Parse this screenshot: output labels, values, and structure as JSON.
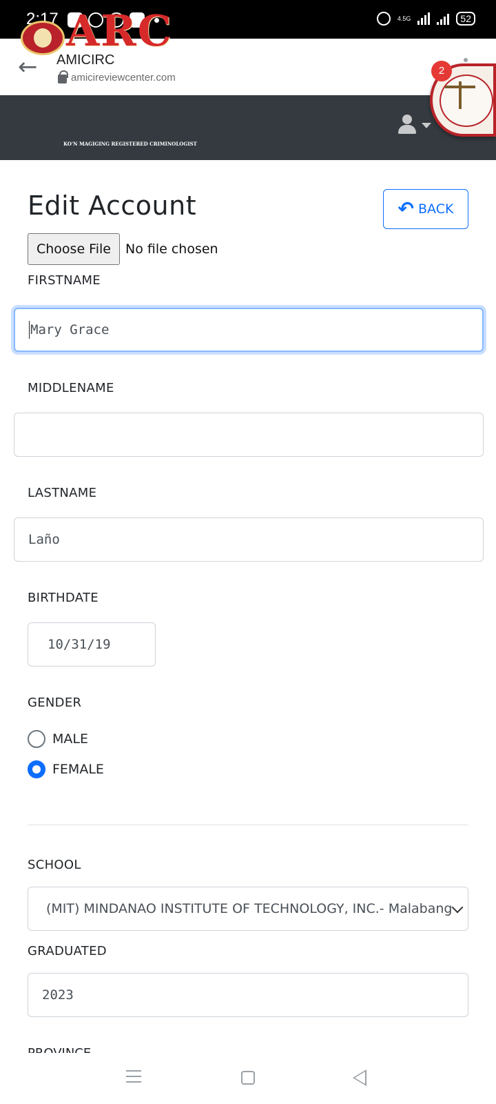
{
  "status_bar": {
    "time": "2:17",
    "network": "4.5G",
    "battery": "52"
  },
  "browser": {
    "page_name": "AMICIRC",
    "url": "amicireviewcenter.com"
  },
  "brand": {
    "logo_text": "ARC",
    "tagline": "KO'N MAGIGING REGISTERED CRIMINOLOGIST",
    "accent": "#d62a2a"
  },
  "chat_head": {
    "badge_count": "2"
  },
  "form": {
    "title": "Edit Account",
    "back_label": "BACK",
    "file": {
      "button_label": "Choose File",
      "status": "No file chosen"
    },
    "firstname": {
      "label": "FIRSTNAME",
      "value": "Mary Grace"
    },
    "middlename": {
      "label": "MIDDLENAME",
      "value": ""
    },
    "lastname": {
      "label": "LASTNAME",
      "value": "Laño"
    },
    "birthdate": {
      "label": "BIRTHDATE",
      "value": "10/31/19"
    },
    "gender": {
      "label": "GENDER",
      "options": [
        "MALE",
        "FEMALE"
      ],
      "selected": "FEMALE"
    },
    "school": {
      "label": "SCHOOL",
      "selected": "(MIT) MINDANAO INSTITUTE OF TECHNOLOGY, INC.- Malabang"
    },
    "graduated": {
      "label": "GRADUATED",
      "value": "2023"
    },
    "next_label": "PROVINCE"
  },
  "colors": {
    "primary": "#0d6efd",
    "navbar": "#343a40"
  }
}
